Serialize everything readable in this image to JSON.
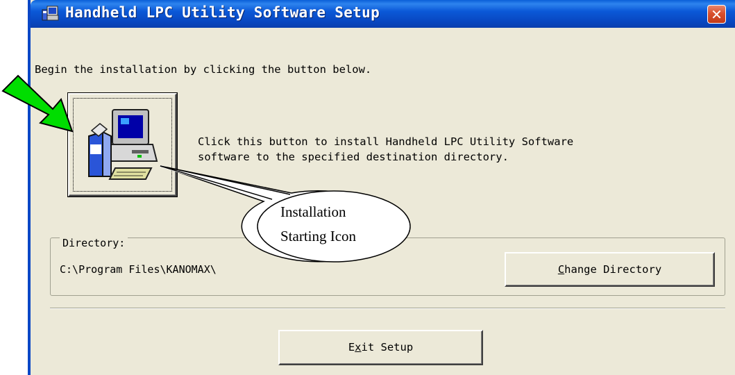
{
  "window": {
    "title": "Handheld LPC Utility Software Setup",
    "close_label": "✕"
  },
  "instruction": "Begin the installation by clicking the button below.",
  "install": {
    "description_line1": "Click this button to install Handheld LPC Utility Software",
    "description_line2": "software to the specified destination directory."
  },
  "directory": {
    "group_label": "Directory:",
    "path": "C:\\Program Files\\KANOMAX\\",
    "change_button": {
      "prefix": "",
      "mnemonic": "C",
      "suffix": "hange Directory"
    }
  },
  "exit_button": {
    "prefix": "E",
    "mnemonic": "x",
    "suffix": "it Setup"
  },
  "annotation": {
    "callout_line1": "Installation",
    "callout_line2": "Starting Icon",
    "arrow_color": "#00dd00"
  },
  "colors": {
    "titlebar": "#0a5fd8",
    "dialog_bg": "#ece9d8",
    "close": "#d9502e"
  }
}
